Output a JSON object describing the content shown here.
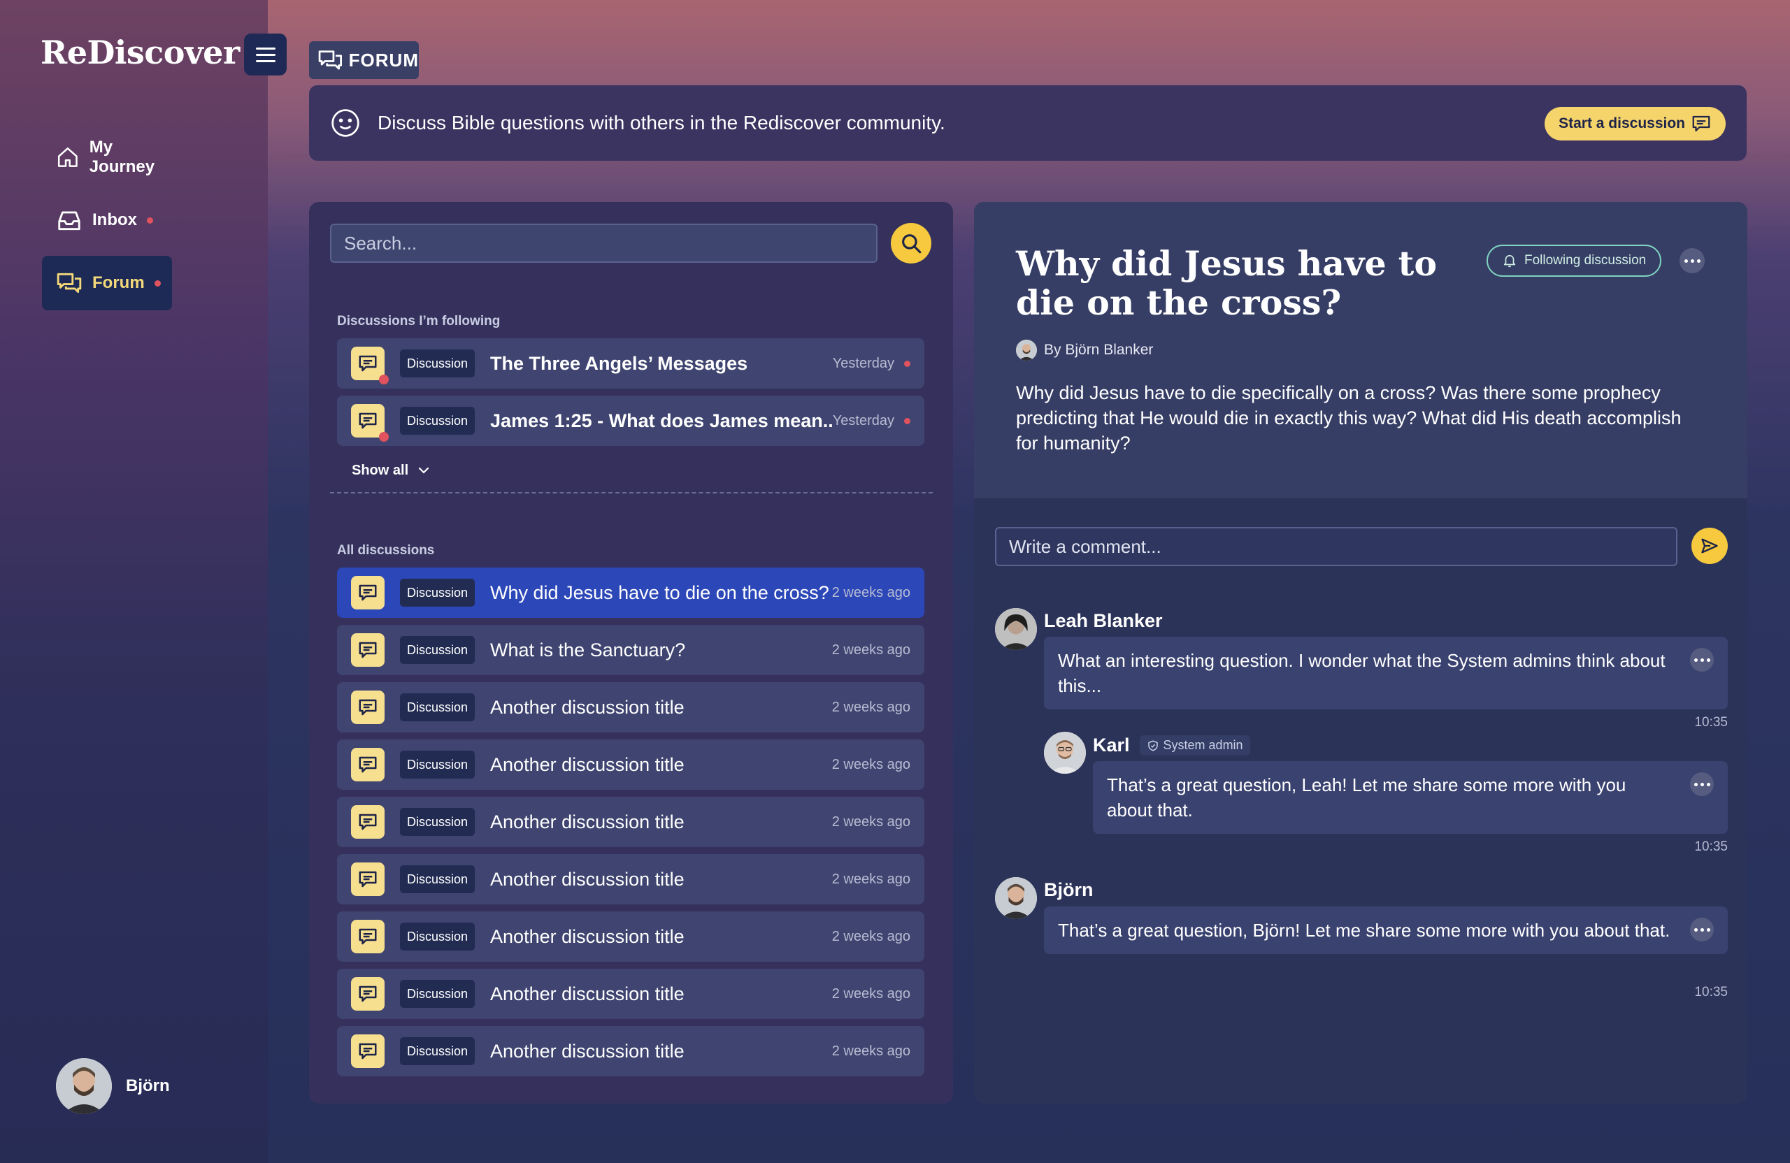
{
  "app": {
    "logo": "ReDiscover"
  },
  "sidebar": {
    "items": [
      {
        "label": "My Journey",
        "icon": "home-icon"
      },
      {
        "label": "Inbox",
        "icon": "inbox-icon",
        "notification": true
      },
      {
        "label": "Forum",
        "icon": "chat-icon",
        "notification": true,
        "active": true
      }
    ],
    "user": {
      "name": "Björn"
    }
  },
  "header": {
    "section_label": "FORUM",
    "banner_text": "Discuss Bible questions with others in the Rediscover community.",
    "start_button": "Start a discussion"
  },
  "list": {
    "search_placeholder": "Search...",
    "following_label": "Discussions I’m following",
    "following": [
      {
        "tag": "Discussion",
        "title": "The Three Angels’ Messages",
        "time": "Yesterday",
        "unread": true
      },
      {
        "tag": "Discussion",
        "title": "James 1:25 - What does James mean...",
        "time": "Yesterday",
        "unread": true
      }
    ],
    "show_all": "Show all",
    "all_label": "All discussions",
    "all": [
      {
        "tag": "Discussion",
        "title": "Why did Jesus have to die on the cross?",
        "time": "2 weeks ago",
        "selected": true
      },
      {
        "tag": "Discussion",
        "title": "What is the Sanctuary?",
        "time": "2 weeks ago"
      },
      {
        "tag": "Discussion",
        "title": "Another discussion title",
        "time": "2 weeks ago"
      },
      {
        "tag": "Discussion",
        "title": "Another discussion title",
        "time": "2 weeks ago"
      },
      {
        "tag": "Discussion",
        "title": "Another discussion title",
        "time": "2 weeks ago"
      },
      {
        "tag": "Discussion",
        "title": "Another discussion title",
        "time": "2 weeks ago"
      },
      {
        "tag": "Discussion",
        "title": "Another discussion title",
        "time": "2 weeks ago"
      },
      {
        "tag": "Discussion",
        "title": "Another discussion title",
        "time": "2 weeks ago"
      },
      {
        "tag": "Discussion",
        "title": "Another discussion title",
        "time": "2 weeks ago"
      }
    ]
  },
  "detail": {
    "title": "Why did Jesus have to die on the cross?",
    "follow_button": "Following discussion",
    "author": "By Björn Blanker",
    "question": "Why did Jesus have to die specifically on a cross? Was there some prophecy predicting that He would die in exactly this way? What did His death accomplish for humanity?",
    "comment_placeholder": "Write a comment...",
    "comments": [
      {
        "name": "Leah Blanker",
        "text": "What an interesting question. I wonder what the System admins think about this...",
        "time": "10:35"
      },
      {
        "name": "Karl",
        "badge": "System admin",
        "text": "That’s a great question, Leah! Let me share some more with you about that.",
        "time": "10:35"
      },
      {
        "name": "Björn",
        "text": "That’s a great question, Björn! Let me share some more with you about that.",
        "time": "10:35"
      }
    ]
  },
  "colors": {
    "accent": "#f6c93e",
    "selected_row": "#2c47b8",
    "notification": "#e0525d",
    "follow_border": "#7fd3c0"
  }
}
